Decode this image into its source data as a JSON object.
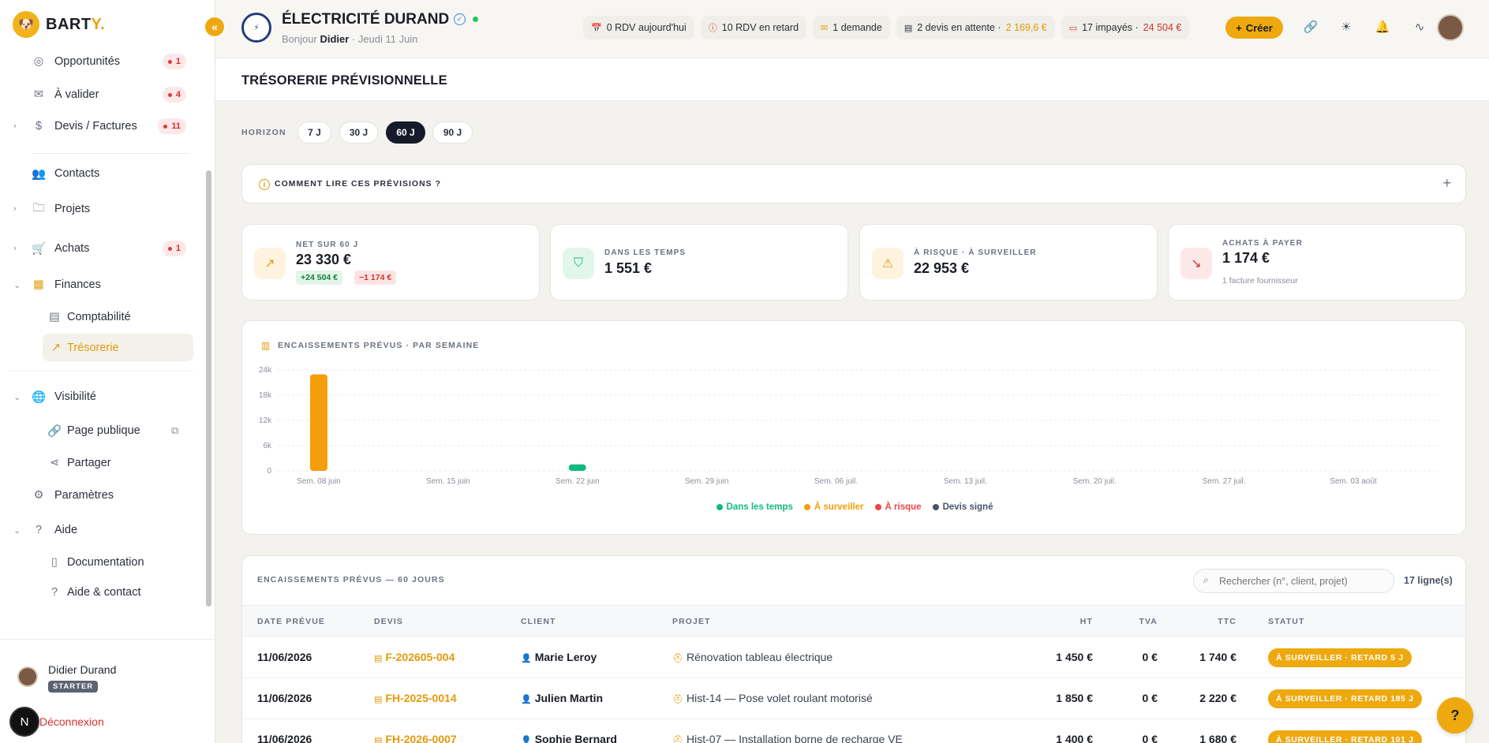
{
  "brand": {
    "name_prefix": "BART",
    "name_suffix": "Y."
  },
  "sidebar": {
    "items": [
      {
        "label": "Opportunités",
        "badge": "1"
      },
      {
        "label": "À valider",
        "badge": "4"
      },
      {
        "label": "Devis / Factures",
        "badge": "11"
      },
      {
        "label": "Contacts"
      },
      {
        "label": "Projets"
      },
      {
        "label": "Achats",
        "badge": "1"
      },
      {
        "label": "Finances"
      },
      {
        "label": "Comptabilité"
      },
      {
        "label": "Trésorerie"
      },
      {
        "label": "Visibilité"
      },
      {
        "label": "Page publique"
      },
      {
        "label": "Partager"
      },
      {
        "label": "Paramètres"
      },
      {
        "label": "Aide"
      },
      {
        "label": "Documentation"
      },
      {
        "label": "Aide & contact"
      }
    ],
    "user": {
      "name": "Didier Durand",
      "plan": "STARTER"
    },
    "logout": "Déconnexion",
    "n_avatar": "N"
  },
  "header": {
    "company": "ÉLECTRICITÉ DURAND",
    "greeting_prefix": "Bonjour",
    "greeting_name": "Didier",
    "greeting_date": "· Jeudi 11 Juin",
    "pills": [
      {
        "text": "0 RDV aujourd'hui"
      },
      {
        "text": "10 RDV en retard"
      },
      {
        "text": "1 demande"
      },
      {
        "text": "2 devis en attente ·",
        "amount": "2 169,6 €"
      },
      {
        "text": "17 impayés ·",
        "amount": "24 504 €"
      }
    ],
    "create_label": "Créer"
  },
  "page": {
    "title": "TRÉSORERIE PRÉVISIONNELLE"
  },
  "horizon": {
    "label": "HORIZON",
    "options": [
      "7 J",
      "30 J",
      "60 J",
      "90 J"
    ],
    "selected": "60 J"
  },
  "info": {
    "title": "COMMENT LIRE CES PRÉVISIONS ?"
  },
  "cards": [
    {
      "label": "NET SUR 60 J",
      "value": "23 330 €",
      "chip_pos": "+24 504 €",
      "chip_neg": "−1 174 €"
    },
    {
      "label": "DANS LES TEMPS",
      "value": "1 551 €"
    },
    {
      "label": "À RISQUE · À SURVEILLER",
      "value": "22 953 €"
    },
    {
      "label": "ACHATS À PAYER",
      "value": "1 174 €",
      "sub": "1 facture fournisseur"
    }
  ],
  "chart_data": {
    "type": "bar",
    "title": "ENCAISSEMENTS PRÉVUS · PAR SEMAINE",
    "categories": [
      "Sem. 08 juin",
      "Sem. 15 juin",
      "Sem. 22 juin",
      "Sem. 29 juin",
      "Sem. 06 juil.",
      "Sem. 13 juil.",
      "Sem. 20 juil.",
      "Sem. 27 juil.",
      "Sem. 03 août"
    ],
    "series": [
      {
        "name": "Dans les temps",
        "color": "#10b981",
        "values": [
          0,
          0,
          1551,
          0,
          0,
          0,
          0,
          0,
          0
        ]
      },
      {
        "name": "À surveiller",
        "color": "#f59e0b",
        "values": [
          22953,
          0,
          0,
          0,
          0,
          0,
          0,
          0,
          0
        ]
      },
      {
        "name": "À risque",
        "color": "#ef4444",
        "values": [
          0,
          0,
          0,
          0,
          0,
          0,
          0,
          0,
          0
        ]
      },
      {
        "name": "Devis signé",
        "color": "#475569",
        "values": [
          0,
          0,
          0,
          0,
          0,
          0,
          0,
          0,
          0
        ]
      }
    ],
    "yticks": [
      "0",
      "6k",
      "12k",
      "18k",
      "24k"
    ],
    "ylim": [
      0,
      24000
    ],
    "grid": true,
    "legend": "bottom"
  },
  "table": {
    "title": "ENCAISSEMENTS PRÉVUS — 60 JOURS",
    "search_placeholder": "Rechercher (n°, client, projet)",
    "row_count": "17 ligne(s)",
    "columns": [
      "DATE PRÉVUE",
      "DEVIS",
      "CLIENT",
      "PROJET",
      "HT",
      "TVA",
      "TTC",
      "STATUT"
    ],
    "rows": [
      {
        "date": "11/06/2026",
        "devis": "F-202605-004",
        "client": "Marie Leroy",
        "projet": "Rénovation tableau électrique",
        "ht": "1 450 €",
        "tva": "0 €",
        "ttc": "1 740 €",
        "statut": "À SURVEILLER · RETARD 5 J"
      },
      {
        "date": "11/06/2026",
        "devis": "FH-2025-0014",
        "client": "Julien Martin",
        "projet": "Hist-14 — Pose volet roulant motorisé",
        "ht": "1 850 €",
        "tva": "0 €",
        "ttc": "2 220 €",
        "statut": "À SURVEILLER · RETARD 185 J"
      },
      {
        "date": "11/06/2026",
        "devis": "FH-2026-0007",
        "client": "Sophie Bernard",
        "projet": "Hist-07 — Installation borne de recharge VE",
        "ht": "1 400 €",
        "tva": "0 €",
        "ttc": "1 680 €",
        "statut": "À SURVEILLER · RETARD 101 J"
      }
    ]
  },
  "colors": {
    "accent": "#eea90f",
    "dark": "#161a2a",
    "danger": "#d6322c",
    "success": "#10b981"
  }
}
